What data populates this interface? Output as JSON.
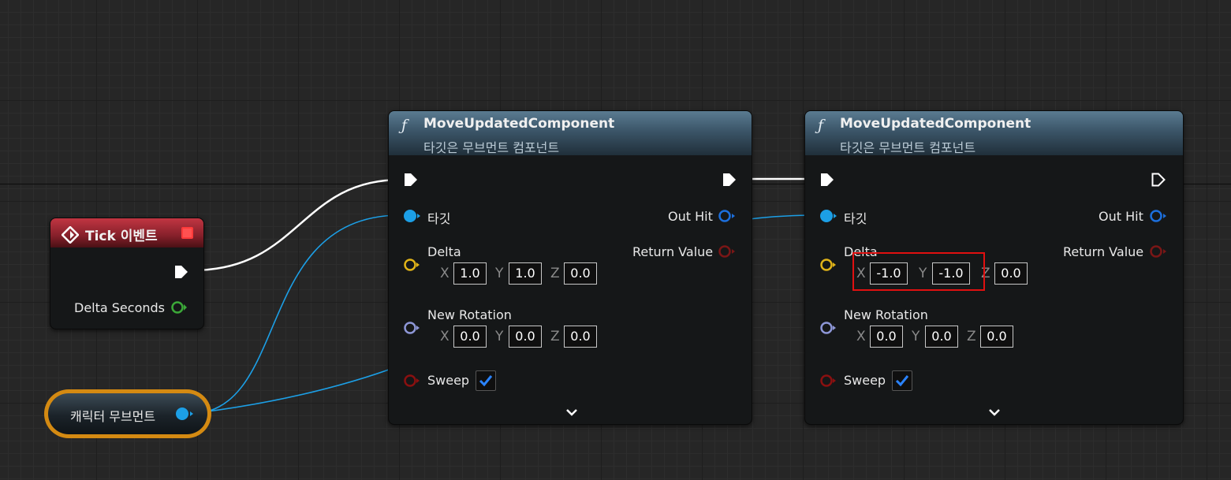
{
  "colors": {
    "exec": "#ffffff",
    "object_pin": "#1c9fe6",
    "float_pin": "#3ba838",
    "vector_pin": "#e0b318",
    "rotator_pin": "#8d96d6",
    "bool_pin": "#8a1010",
    "hit_pin": "#1c6fdc",
    "return_pin": "#7a1616",
    "highlight": "#e01010",
    "variable_border": "#d48a12"
  },
  "tick_event": {
    "title": "Tick 이벤트",
    "icon": "event-diamond-icon",
    "output_label": "Delta Seconds"
  },
  "variable_node": {
    "label": "캐릭터 무브먼트"
  },
  "node1": {
    "title": "MoveUpdatedComponent",
    "subtitle": "타깃은 무브먼트 컴포넌트",
    "target_label": "타깃",
    "delta_label": "Delta",
    "delta": {
      "x_axis": "X",
      "x": "1.0",
      "y_axis": "Y",
      "y": "1.0",
      "z_axis": "Z",
      "z": "0.0"
    },
    "rotation_label": "New Rotation",
    "rotation": {
      "x_axis": "X",
      "x": "0.0",
      "y_axis": "Y",
      "y": "0.0",
      "z_axis": "Z",
      "z": "0.0"
    },
    "sweep_label": "Sweep",
    "sweep_checked": true,
    "out_hit_label": "Out Hit",
    "return_label": "Return Value"
  },
  "node2": {
    "title": "MoveUpdatedComponent",
    "subtitle": "타깃은 무브먼트 컴포넌트",
    "target_label": "타깃",
    "delta_label": "Delta",
    "delta": {
      "x_axis": "X",
      "x": "-1.0",
      "y_axis": "Y",
      "y": "-1.0",
      "z_axis": "Z",
      "z": "0.0"
    },
    "rotation_label": "New Rotation",
    "rotation": {
      "x_axis": "X",
      "x": "0.0",
      "y_axis": "Y",
      "y": "0.0",
      "z_axis": "Z",
      "z": "0.0"
    },
    "sweep_label": "Sweep",
    "sweep_checked": true,
    "out_hit_label": "Out Hit",
    "return_label": "Return Value"
  }
}
